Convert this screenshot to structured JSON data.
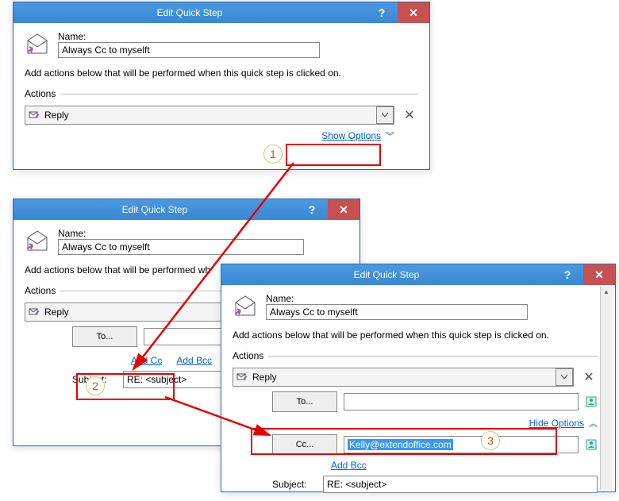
{
  "dialog_title": "Edit Quick Step",
  "name_label": "Name:",
  "name_value": "Always Cc to myselft",
  "instructions": "Add actions below that will be performed when this quick step is clicked on.",
  "actions_label": "Actions",
  "action_value": "Reply",
  "show_options": "Show Options",
  "hide_options": "Hide Options",
  "to_btn": "To...",
  "cc_btn": "Cc...",
  "add_cc": "Add Cc",
  "add_bcc": "Add Bcc",
  "subject_label": "Subject:",
  "subject_value": "RE: <subject>",
  "cc_email": "Kelly@extendoffice.com",
  "steps": {
    "one": "1",
    "two": "2",
    "three": "3"
  }
}
